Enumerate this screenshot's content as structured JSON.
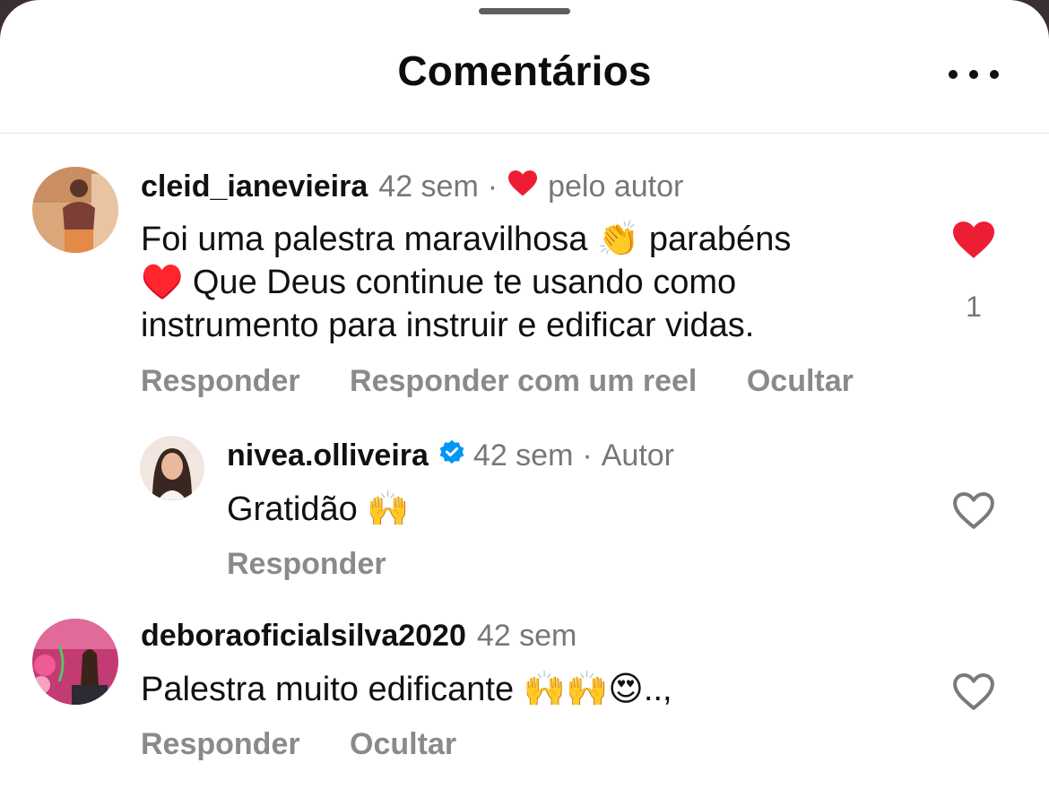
{
  "header": {
    "title": "Comentários"
  },
  "comments": [
    {
      "username": "cleid_ianevieira",
      "time": "42 sem",
      "separator": "·",
      "liked_by_author_label": "pelo autor",
      "text_line1": "Foi uma palestra maravilhosa 👏 parabéns",
      "text_line2": "♥️ Que Deus continue te usando como",
      "text_line3": "instrumento para instruir e edificar vidas.",
      "like_count": "1",
      "liked": true,
      "actions": {
        "reply": "Responder",
        "reply_reel": "Responder com um reel",
        "hide": "Ocultar"
      }
    },
    {
      "username": "nivea.olliveira",
      "verified": true,
      "time": "42 sem",
      "separator": "·",
      "author_label": "Autor",
      "text": "Gratidão 🙌",
      "liked": false,
      "actions": {
        "reply": "Responder"
      }
    },
    {
      "username": "deboraoficialsilva2020",
      "time": "42 sem",
      "text": "Palestra muito edificante 🙌🙌😍..,",
      "liked": false,
      "actions": {
        "reply": "Responder",
        "hide": "Ocultar"
      }
    }
  ],
  "colors": {
    "heart_red": "#ed1d34",
    "verified_blue": "#0095f6",
    "muted_text": "#777777"
  },
  "icons": [
    "more-icon",
    "heart-filled-icon",
    "heart-outline-icon",
    "verified-badge-icon"
  ]
}
